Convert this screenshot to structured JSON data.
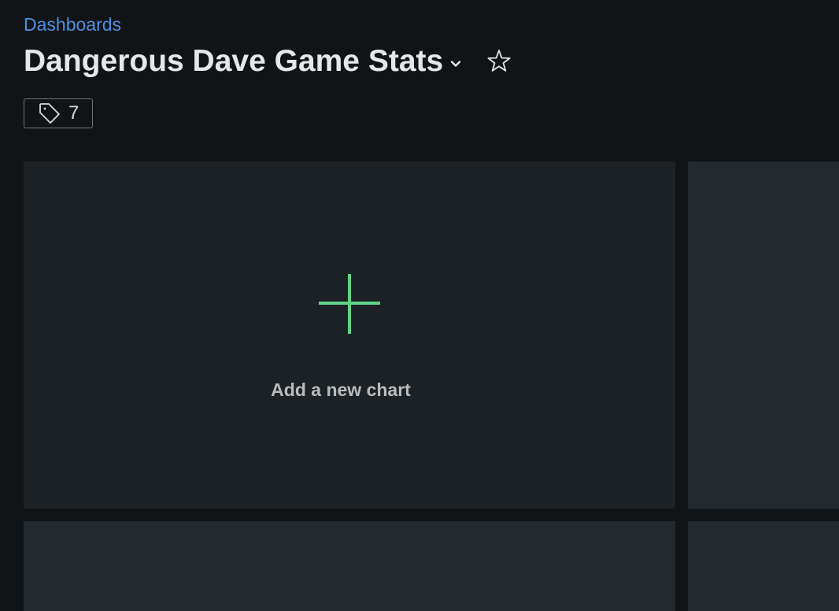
{
  "breadcrumb": {
    "label": "Dashboards"
  },
  "dashboard": {
    "title": "Dangerous Dave Game Stats",
    "title_menu_icon": "chevron-down-icon",
    "favorite_icon": "star-outline-icon"
  },
  "tags": {
    "icon": "tag-icon",
    "count": "7"
  },
  "add_chart": {
    "icon": "plus-icon",
    "label": "Add a new chart"
  },
  "colors": {
    "background": "#111416",
    "panel": "#22292f",
    "panel_add": "#1c2125",
    "link": "#4a90e2",
    "accent_plus": "#5fd38a",
    "title_text": "#e6e7e8"
  }
}
